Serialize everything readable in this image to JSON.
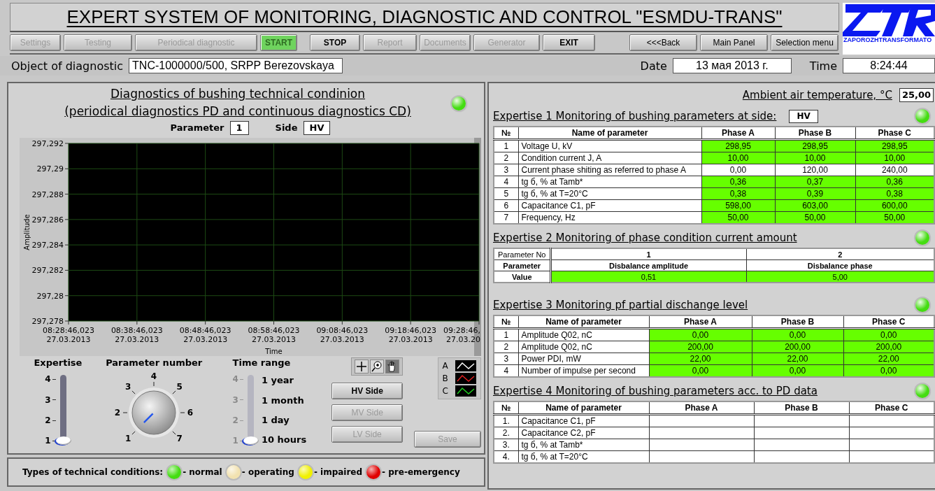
{
  "title": "EXPERT SYSTEM OF MONITORING, DIAGNOSTIC AND CONTROL \"ESMDU-TRANS\"",
  "logo": {
    "caption": "ZAPOROZHTRANSFORMATO"
  },
  "toolbar": [
    {
      "label": "Settings",
      "disabled": true,
      "active": false
    },
    {
      "label": "Testing",
      "disabled": true,
      "active": false
    },
    {
      "label": "Periodical diagnostic",
      "disabled": true,
      "active": false
    },
    {
      "label": "START",
      "disabled": false,
      "active": true
    },
    {
      "label": "STOP",
      "disabled": false,
      "active": false
    },
    {
      "label": "Report",
      "disabled": true,
      "active": false
    },
    {
      "label": "Documents",
      "disabled": true,
      "active": false
    },
    {
      "label": "Generator",
      "disabled": true,
      "active": false
    },
    {
      "label": "EXIT",
      "disabled": false,
      "active": false
    }
  ],
  "nav_buttons": [
    {
      "label": "<<<Back"
    },
    {
      "label": "Main Panel"
    },
    {
      "label": "Selection menu"
    }
  ],
  "object": {
    "label": "Object of diagnostic",
    "value": "TNC-1000000/500, SRPP Berezovskaya"
  },
  "date": {
    "label": "Date",
    "value": "13 мая 2013 г."
  },
  "time": {
    "label": "Time",
    "value": "8:24:44"
  },
  "diagnostics": {
    "title_lines": [
      "Diagnostics of bushing technical condinion",
      "(periodical diagnostics PD and continuous diagnostics CD)"
    ],
    "status_light": {
      "color": "#44dd11"
    },
    "parameter": {
      "label": "Parameter",
      "value": "1"
    },
    "side": {
      "label": "Side",
      "value": "HV"
    },
    "chart": {
      "xlabel": "Time",
      "ylabel": "Amplitude",
      "y_labels": [
        "297,292",
        "297,29",
        "297,288",
        "297,286",
        "297,284",
        "297,282",
        "297,28",
        "297,278"
      ],
      "x_labels": [
        "08:28:46,023\n27.03.2013",
        "08:38:46,023\n27.03.2013",
        "08:48:46,023\n27.03.2013",
        "08:58:46,023\n27.03.2013",
        "09:08:46,023\n27.03.2013",
        "09:18:46,023\n27.03.2013",
        "09:28:46,\n27.03.20"
      ]
    },
    "plot_legend": [
      {
        "name": "A",
        "color": "#ffffff"
      },
      {
        "name": "B",
        "color": "#e02020"
      },
      {
        "name": "C",
        "color": "#20d020"
      }
    ],
    "expertise_slider": {
      "label": "Expertise",
      "ticks": [
        "4",
        "3",
        "2",
        "1"
      ],
      "level": 0
    },
    "parameter_knob": {
      "label": "Parameter number",
      "ticks": [
        {
          "label": "1",
          "selected": true
        },
        {
          "label": "2",
          "selected": false
        },
        {
          "label": "3",
          "selected": false
        },
        {
          "label": "4",
          "selected": false
        },
        {
          "label": "5",
          "selected": false
        },
        {
          "label": "6",
          "selected": false
        },
        {
          "label": "7",
          "selected": false
        }
      ]
    },
    "time_range": {
      "label": "Time range",
      "ticks": [
        "4",
        "3",
        "2",
        "1"
      ],
      "options": [
        "1 year",
        "1 month",
        "1 day",
        "10 hours"
      ],
      "level": 0
    },
    "side_buttons": [
      {
        "label": "HV Side",
        "disabled": false
      },
      {
        "label": "MV Side",
        "disabled": true
      },
      {
        "label": "LV Side",
        "disabled": true
      }
    ],
    "save_button": {
      "label": "Save",
      "disabled": true
    }
  },
  "condition_legend": {
    "label": "Types of technical conditions:",
    "items": [
      {
        "label": "- normal",
        "color": "#44dd11"
      },
      {
        "label": "- operating",
        "color": "#f2e2b0"
      },
      {
        "label": "- impaired",
        "color": "#f0f000"
      },
      {
        "label": "- pre-emergency",
        "color": "#e00000"
      }
    ]
  },
  "ambient": {
    "label": "Ambient air temperature, °C",
    "value": "25,00"
  },
  "expertise_1": {
    "title": "Expertise 1 Monitoring of bushing parameters at side:",
    "side": "HV",
    "status_light": {
      "color": "#44dd11"
    },
    "columns": [
      "№",
      "Name of parameter",
      "Phase A",
      "Phase B",
      "Phase C"
    ],
    "rows": [
      {
        "cells": [
          "1",
          "Voltage U, kV",
          "298,95",
          "298,95",
          "298,95"
        ],
        "highlighted": true
      },
      {
        "cells": [
          "2",
          "Condition current J, A",
          "10,00",
          "10,00",
          "10,00"
        ],
        "highlighted": true
      },
      {
        "cells": [
          "3",
          "Current phase shiting as referred to phase A",
          "0,00",
          "120,00",
          "240,00"
        ],
        "highlighted": false
      },
      {
        "cells": [
          "4",
          "tg б, % at Tamb*",
          "0,36",
          "0,37",
          "0,36"
        ],
        "highlighted": true
      },
      {
        "cells": [
          "5",
          "tg б, % at T=20°C",
          "0,38",
          "0,39",
          "0,38"
        ],
        "highlighted": true
      },
      {
        "cells": [
          "6",
          "Capacitance C1, pF",
          "598,00",
          "603,00",
          "600,00"
        ],
        "highlighted": true
      },
      {
        "cells": [
          "7",
          "Frequency, Hz",
          "50,00",
          "50,00",
          "50,00"
        ],
        "highlighted": true
      }
    ]
  },
  "expertise_2": {
    "title": "Expertise 2 Monitoring of phase condition current amount",
    "status_light": {
      "color": "#44dd11"
    },
    "rows": [
      {
        "cells": [
          "Parameter No",
          "1",
          "2"
        ],
        "highlighted": false
      },
      {
        "cells": [
          "Parameter",
          "Disbalance amplitude",
          "Disbalance phase"
        ],
        "highlighted": false
      },
      {
        "cells": [
          "Value",
          "0,51",
          "5,00"
        ],
        "highlighted": true
      }
    ]
  },
  "expertise_3": {
    "title": "Expertise 3 Monitoring pf partial dischange level",
    "status_light": {
      "color": "#44dd11"
    },
    "columns": [
      "№",
      "Name of parameter",
      "Phase A",
      "Phase B",
      "Phase C"
    ],
    "rows": [
      {
        "cells": [
          "1",
          "Amplitude Q02, nC",
          "0,00",
          "0,00",
          "0,00"
        ],
        "highlighted": true
      },
      {
        "cells": [
          "2",
          "Amplitude Q02, nC",
          "200,00",
          "200,00",
          "200,00"
        ],
        "highlighted": true
      },
      {
        "cells": [
          "3",
          "Power PDI, mW",
          "22,00",
          "22,00",
          "22,00"
        ],
        "highlighted": true
      },
      {
        "cells": [
          "4",
          "Number of impulse per second",
          "0,00",
          "0,00",
          "0,00"
        ],
        "highlighted": true
      }
    ]
  },
  "expertise_4": {
    "title": "Expertise 4 Monitoring of bushing parameters acc. to PD data",
    "status_light": {
      "color": "#44dd11"
    },
    "columns": [
      "№",
      "Name of parameter",
      "Phase A",
      "Phase B",
      "Phase C"
    ],
    "rows": [
      {
        "cells": [
          "1.",
          "Capacitance C1, pF"
        ]
      },
      {
        "cells": [
          "2.",
          "Capacitance C2, pF"
        ]
      },
      {
        "cells": [
          "3.",
          "tg б, % at Tamb*"
        ]
      },
      {
        "cells": [
          "4.",
          "tg б, % at T=20°C"
        ]
      }
    ]
  }
}
